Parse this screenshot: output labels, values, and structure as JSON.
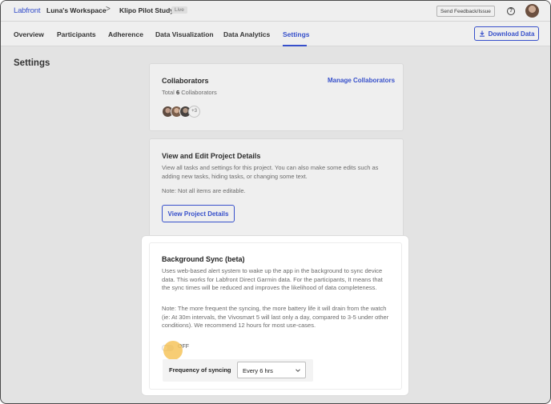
{
  "topbar": {
    "logo": "Labfront",
    "workspace": "Luna's Workspace",
    "separator": ">",
    "study": "Klipo Pilot Study",
    "status_badge": "Live",
    "feedback_button": "Send Feedback/Issue",
    "help_icon": "question-icon",
    "help_glyph": "?",
    "avatar_icon": "user-avatar"
  },
  "nav": {
    "tabs": [
      {
        "label": "Overview"
      },
      {
        "label": "Participants"
      },
      {
        "label": "Adherence"
      },
      {
        "label": "Data Visualization"
      },
      {
        "label": "Data Analytics"
      },
      {
        "label": "Settings"
      }
    ],
    "active_tab": "Settings",
    "download_button": "Download Data",
    "download_icon": "download-icon"
  },
  "page": {
    "title": "Settings"
  },
  "collaborators": {
    "title": "Collaborators",
    "manage_link": "Manage Collaborators",
    "total_prefix": "Total ",
    "total_count": "6",
    "total_suffix": " Collaborators",
    "more_count": "+3"
  },
  "project_details": {
    "title": "View and Edit Project Details",
    "description": "View all tasks and settings for this project. You can also make some edits such as adding new tasks, hiding tasks, or changing some text.",
    "note": "Note: Not all items are editable.",
    "button": "View Project Details"
  },
  "background_sync": {
    "title": "Background Sync (beta)",
    "description": "Uses web-based alert system to wake up the app in the background to sync device data. This works for Labfront Direct Garmin data. For the participants, It means that the sync times will be reduced and improves the likelihood of data completeness.",
    "note": "Note: The more frequent the syncing, the more battery life it will drain from the watch (ie: At 30m intervals, the Vivosmart 5 will last only a day, compared to 3-5 under other conditions). We recommend 12 hours for most use-cases.",
    "toggle_state": "OFF",
    "frequency_label": "Frequency of syncing",
    "frequency_value": "Every 6 hrs",
    "dropdown_icon": "chevron-down-icon"
  },
  "colors": {
    "accent": "#2e4bd6",
    "highlight_dot": "#f6c45c"
  }
}
